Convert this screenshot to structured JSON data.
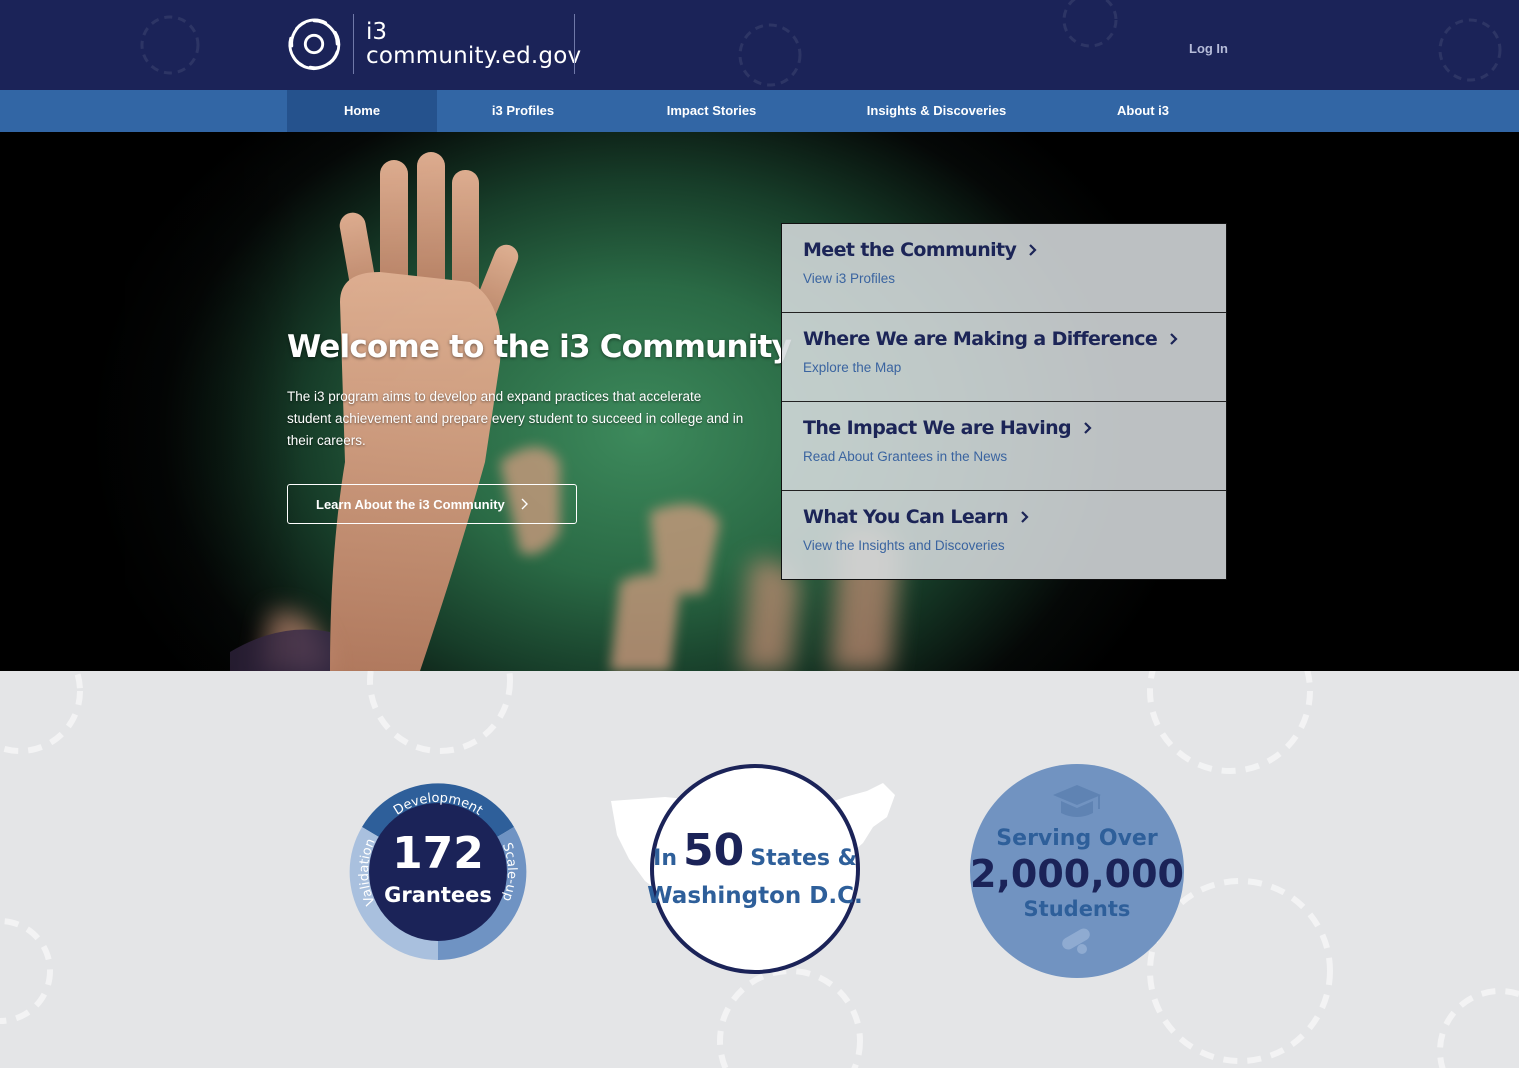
{
  "header": {
    "logo_line1": "i3",
    "logo_line2": "community.ed.gov",
    "login_label": "Log In"
  },
  "nav": {
    "items": [
      {
        "label": "Home",
        "active": true
      },
      {
        "label": "i3 Profiles",
        "active": false
      },
      {
        "label": "Impact Stories",
        "active": false
      },
      {
        "label": "Insights & Discoveries",
        "active": false
      },
      {
        "label": "About i3",
        "active": false
      }
    ]
  },
  "hero": {
    "title": "Welcome to the i3 Community",
    "description": "The i3 program aims to develop and expand practices that accelerate student achievement and prepare every student to succeed in college and in their careers.",
    "button_label": "Learn About the i3 Community"
  },
  "cards": [
    {
      "title": "Meet the Community",
      "subtitle": "View i3 Profiles"
    },
    {
      "title": "Where We are Making a Difference",
      "subtitle": "Explore the Map"
    },
    {
      "title": "The Impact We are Having",
      "subtitle": "Read About Grantees in the News"
    },
    {
      "title": "What You Can Learn",
      "subtitle": "View the Insights and Discoveries"
    }
  ],
  "stats": {
    "grantees": {
      "number": "172",
      "label": "Grantees",
      "segments": [
        "Development",
        "Scale-up",
        "Validation"
      ]
    },
    "states": {
      "prefix": "In",
      "number": "50",
      "suffix": "States &",
      "line2": "Washington D.C."
    },
    "students": {
      "line1": "Serving Over",
      "number": "2,000,000",
      "line3": "Students"
    }
  },
  "colors": {
    "header_bg": "#1b2358",
    "nav_bg": "#3266a5",
    "nav_active": "#25528d",
    "card_title": "#1c2557",
    "card_link": "#3a64a0",
    "stats_bg": "#e4e5e7"
  },
  "icons": [
    "swirl-logo-icon",
    "chevron-right-icon",
    "graduation-cap-icon",
    "diploma-icon",
    "us-map-icon"
  ]
}
